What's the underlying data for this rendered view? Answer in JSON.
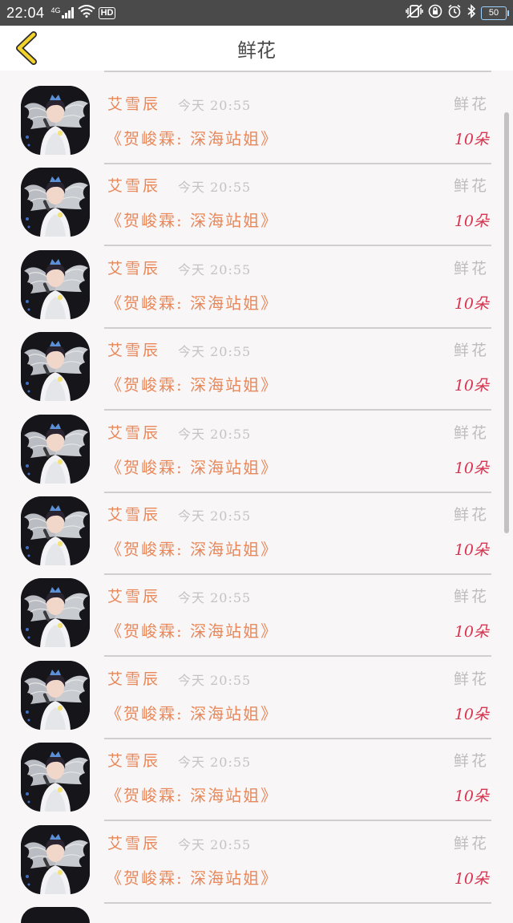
{
  "status_bar": {
    "time": "22:04",
    "network_label": "4G",
    "hd_label": "HD",
    "battery_level": "50",
    "battery_color": "#9bd2ff"
  },
  "header": {
    "title": "鲜花",
    "back_icon": "chevron-left-icon",
    "back_icon_color": "#f2d22b"
  },
  "list": {
    "items": [
      {
        "name": "艾雪辰",
        "time": "今天 20:55",
        "category": "鲜花",
        "title": "《贺峻霖: 深海站姐》",
        "count": "10朵"
      },
      {
        "name": "艾雪辰",
        "time": "今天 20:55",
        "category": "鲜花",
        "title": "《贺峻霖: 深海站姐》",
        "count": "10朵"
      },
      {
        "name": "艾雪辰",
        "time": "今天 20:55",
        "category": "鲜花",
        "title": "《贺峻霖: 深海站姐》",
        "count": "10朵"
      },
      {
        "name": "艾雪辰",
        "time": "今天 20:55",
        "category": "鲜花",
        "title": "《贺峻霖: 深海站姐》",
        "count": "10朵"
      },
      {
        "name": "艾雪辰",
        "time": "今天 20:55",
        "category": "鲜花",
        "title": "《贺峻霖: 深海站姐》",
        "count": "10朵"
      },
      {
        "name": "艾雪辰",
        "time": "今天 20:55",
        "category": "鲜花",
        "title": "《贺峻霖: 深海站姐》",
        "count": "10朵"
      },
      {
        "name": "艾雪辰",
        "time": "今天 20:55",
        "category": "鲜花",
        "title": "《贺峻霖: 深海站姐》",
        "count": "10朵"
      },
      {
        "name": "艾雪辰",
        "time": "今天 20:55",
        "category": "鲜花",
        "title": "《贺峻霖: 深海站姐》",
        "count": "10朵"
      },
      {
        "name": "艾雪辰",
        "time": "今天 20:55",
        "category": "鲜花",
        "title": "《贺峻霖: 深海站姐》",
        "count": "10朵"
      },
      {
        "name": "艾雪辰",
        "time": "今天 20:55",
        "category": "鲜花",
        "title": "《贺峻霖: 深海站姐》",
        "count": "10朵"
      }
    ]
  },
  "colors": {
    "accent": "#e8885a",
    "count": "#d8344f",
    "muted": "#c3c3c3",
    "background": "#f8f6f7"
  }
}
